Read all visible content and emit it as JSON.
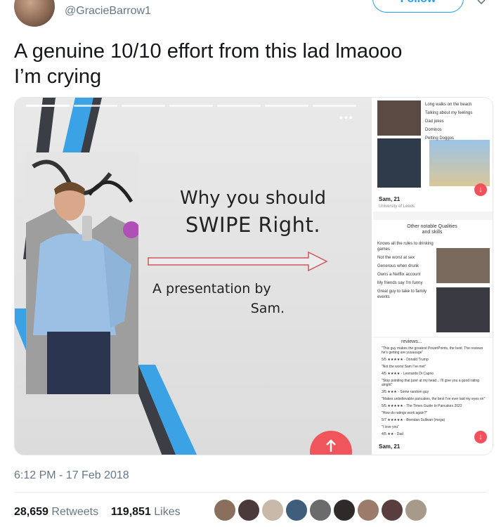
{
  "tweet": {
    "handle": "@GracieBarrow1",
    "follow_label": "Follow",
    "text_line1": "A genuine 10/10 effort from this lad lmaooo",
    "text_line2": "I’m crying",
    "timestamp": "6:12 PM - 17 Feb 2018",
    "retweets_count": "28,659",
    "retweets_label": "Retweets",
    "likes_count": "119,851",
    "likes_label": "Likes"
  },
  "slide": {
    "title_line1": "Why you should",
    "title_line2": "SWIPE Right.",
    "byline_line1": "A presentation by",
    "byline_line2": "Sam.",
    "dots": "•••"
  },
  "side_cards": {
    "card1": {
      "bullets": [
        "Long walks on the beach",
        "Talking about my feelings",
        "Dad jokes",
        "Dominos",
        "Petting Doggos"
      ],
      "name": "Sam, 21",
      "school": "University of Leeds"
    },
    "card2": {
      "title_line1": "Other notable Qualities",
      "title_line2": "and skills",
      "items": [
        "Knows all the rules to drinking games",
        "Not the worst at sex",
        "Generous when drunk",
        "Owns a Netflix account",
        "My friends say I'm funny",
        "Great guy to take to family events"
      ]
    },
    "card3": {
      "header": "reviews...",
      "reviews": [
        "\"This guy makes the greatest PowerPoints, the best. The reviews he's getting are yuuuuuge\"",
        "5/5 ★★★★★ - Donald Trump",
        "\"Not the worst Sam I've met\"",
        "4/5 ★★★★ - Leonardo Di Caprio",
        "\"Stop pointing that jurer at my head... I'll give you a good rating alright\"",
        "3/5 ★★★ - Some random guy",
        "\"Makes unbelievable pancakes, the best I've ever laid my eyes on\"",
        "5/5 ★★★★★ - The Times Guide to Pancakes 2022",
        "\"How do ratings work again?\"",
        "5/7 ★★★★★ - Brendan Sullivan (mega)",
        "\"I love you\"",
        "4/5 ★★ - Dad"
      ],
      "name": "Sam, 21"
    }
  },
  "colors": {
    "twitter_blue": "#1da1f2",
    "tinder_red": "#f1555c",
    "stripe_blue": "#3ba2e6",
    "stripe_dark": "#3b3f45"
  }
}
